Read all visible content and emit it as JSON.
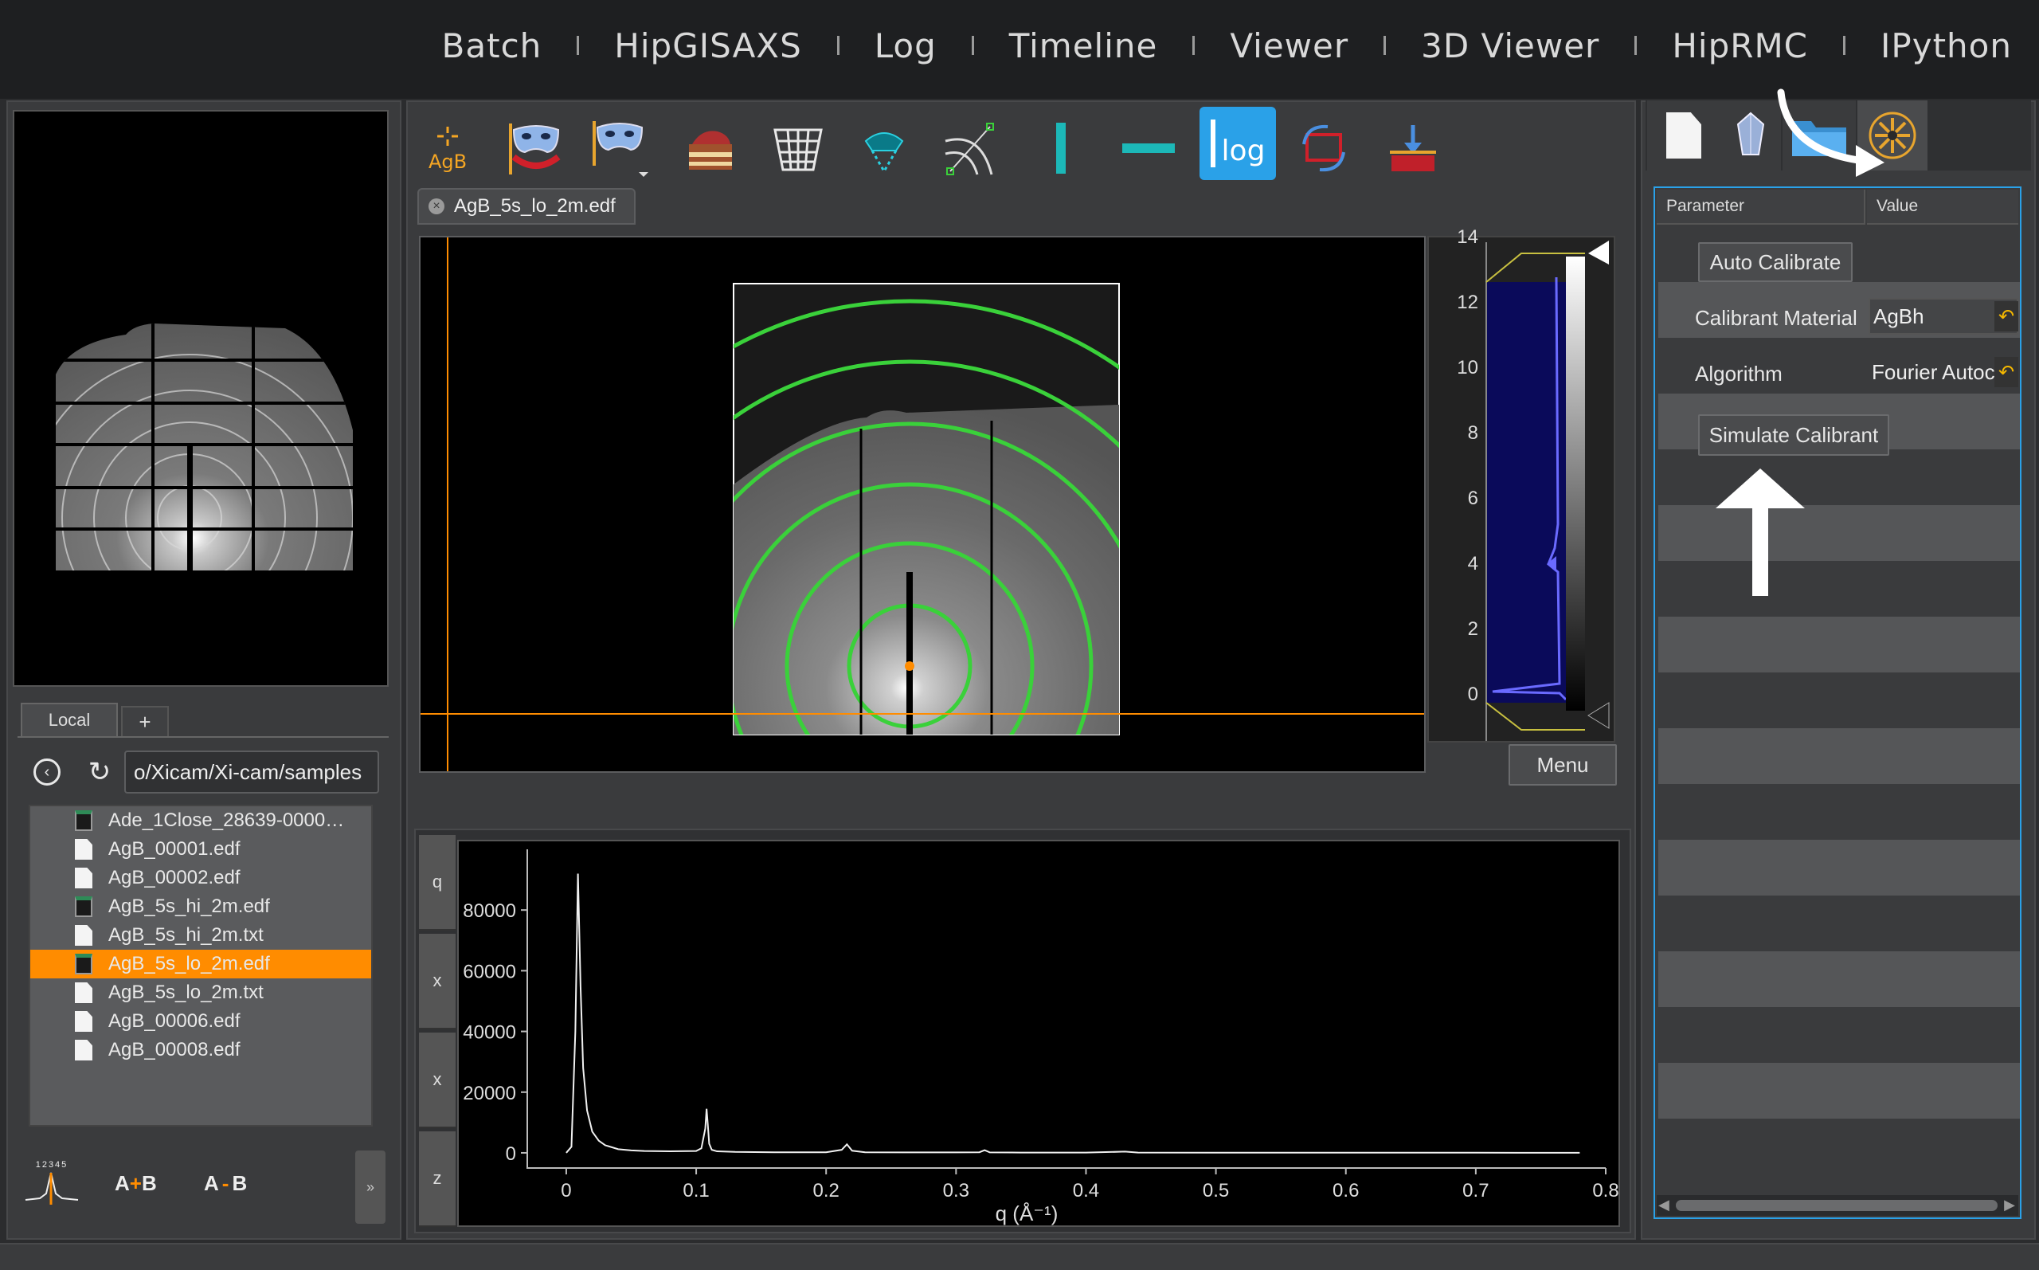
{
  "nav": {
    "items": [
      "Batch",
      "HipGISAXS",
      "Log",
      "Timeline",
      "Viewer",
      "3D Viewer",
      "HipRMC",
      "IPython"
    ]
  },
  "toolbar": {
    "agb_label": "AgB",
    "log_label": "log"
  },
  "document_tab": {
    "label": "AgB_5s_lo_2m.edf"
  },
  "histogram": {
    "ticks": [
      "14",
      "12",
      "10",
      "8",
      "6",
      "4",
      "2",
      "0"
    ],
    "menu_label": "Menu"
  },
  "browser": {
    "tab_local": "Local",
    "tab_add": "+",
    "path": "o/Xicam/Xi-cam/samples",
    "files": [
      {
        "name": "Ade_1Close_28639-0000…",
        "icon": "image-file-icon",
        "selected": false
      },
      {
        "name": "AgB_00001.edf",
        "icon": "document-icon",
        "selected": false
      },
      {
        "name": "AgB_00002.edf",
        "icon": "document-icon",
        "selected": false
      },
      {
        "name": "AgB_5s_hi_2m.edf",
        "icon": "image-file-icon",
        "selected": false
      },
      {
        "name": "AgB_5s_hi_2m.txt",
        "icon": "document-icon",
        "selected": false
      },
      {
        "name": "AgB_5s_lo_2m.edf",
        "icon": "image-file-icon",
        "selected": true
      },
      {
        "name": "AgB_5s_lo_2m.txt",
        "icon": "document-icon",
        "selected": false
      },
      {
        "name": "AgB_00006.edf",
        "icon": "document-icon",
        "selected": false
      },
      {
        "name": "AgB_00008.edf",
        "icon": "document-icon",
        "selected": false
      }
    ],
    "bottom": {
      "numbers": "12345",
      "sum_a": "A",
      "sum_op": "+",
      "sum_b": "B",
      "diff_a": "A",
      "diff_op": "-",
      "diff_b": "B",
      "expand": "»"
    }
  },
  "plot_tabs": [
    "q",
    "x",
    "x",
    "z"
  ],
  "parameters": {
    "header_param": "Parameter",
    "header_value": "Value",
    "auto_calibrate": "Auto Calibrate",
    "calibrant_label": "Calibrant Material",
    "calibrant_value": "AgBh",
    "algorithm_label": "Algorithm",
    "algorithm_value": "Fourier Autoc",
    "simulate": "Simulate Calibrant"
  },
  "colors": {
    "accent_orange": "#ff8c00",
    "selected_blue": "#2aa1e8",
    "ring_green": "#3ad13a"
  },
  "chart_data": {
    "type": "line",
    "xlabel": "q (Å⁻¹)",
    "xticks": [
      "0",
      "0.1",
      "0.2",
      "0.3",
      "0.4",
      "0.5",
      "0.6",
      "0.7",
      "0.8"
    ],
    "yticks": [
      "80000",
      "60000",
      "40000",
      "20000",
      "0"
    ],
    "xlim": [
      -0.03,
      0.8
    ],
    "ylim": [
      -5000,
      100000
    ],
    "series": [
      {
        "x": [
          0.0,
          0.004,
          0.007,
          0.009,
          0.011,
          0.013,
          0.016,
          0.02,
          0.025,
          0.03,
          0.04,
          0.05,
          0.06,
          0.08,
          0.1,
          0.104,
          0.107,
          0.108,
          0.109,
          0.11,
          0.112,
          0.116,
          0.13,
          0.16,
          0.2,
          0.212,
          0.216,
          0.22,
          0.23,
          0.26,
          0.3,
          0.318,
          0.322,
          0.326,
          0.35,
          0.4,
          0.43,
          0.44,
          0.5,
          0.6,
          0.7,
          0.78
        ],
        "y": [
          0,
          2000,
          40000,
          92000,
          55000,
          28000,
          14000,
          7000,
          4000,
          2500,
          1200,
          800,
          600,
          500,
          600,
          1500,
          8000,
          14500,
          9000,
          3000,
          1000,
          500,
          300,
          200,
          200,
          1000,
          2800,
          700,
          200,
          150,
          150,
          200,
          900,
          150,
          100,
          80,
          400,
          80,
          60,
          50,
          40,
          30
        ]
      }
    ]
  }
}
